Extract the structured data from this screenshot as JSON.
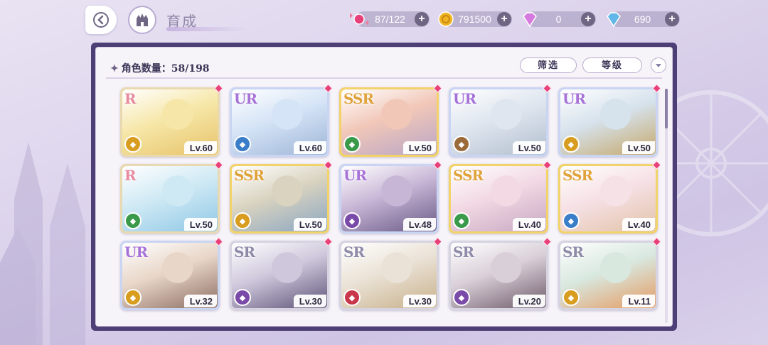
{
  "header": {
    "title": "育成",
    "back_icon": "back-arrow-icon",
    "home_icon": "castle-home-icon"
  },
  "resources": [
    {
      "name": "candy",
      "icon": "candy-icon",
      "value": "87/122",
      "color": "#e8417a"
    },
    {
      "name": "gold",
      "icon": "gold-coin-icon",
      "value": "791500",
      "color": "#f0b323"
    },
    {
      "name": "pink-diamond",
      "icon": "pink-diamond-icon",
      "value": "0",
      "color": "#d77adf"
    },
    {
      "name": "blue-diamond",
      "icon": "blue-diamond-icon",
      "value": "690",
      "color": "#62b7e8"
    }
  ],
  "panel": {
    "count_label": "角色数量：58/198",
    "filter_label": "筛选",
    "sort_label": "等级"
  },
  "cards": [
    {
      "rarity": "R",
      "level": "Lv.60",
      "elem": "#d89c1f"
    },
    {
      "rarity": "UR",
      "level": "Lv.60",
      "elem": "#3a7ec9"
    },
    {
      "rarity": "SSR",
      "level": "Lv.50",
      "elem": "#3a9a4a"
    },
    {
      "rarity": "UR",
      "level": "Lv.50",
      "elem": "#9a6a3a"
    },
    {
      "rarity": "UR",
      "level": "Lv.50",
      "elem": "#d89c1f"
    },
    {
      "rarity": "R",
      "level": "Lv.50",
      "elem": "#3a9a4a"
    },
    {
      "rarity": "SSR",
      "level": "Lv.50",
      "elem": "#d89c1f"
    },
    {
      "rarity": "UR",
      "level": "Lv.48",
      "elem": "#7a4aa8"
    },
    {
      "rarity": "SSR",
      "level": "Lv.40",
      "elem": "#3a9a4a"
    },
    {
      "rarity": "SSR",
      "level": "Lv.40",
      "elem": "#3a7ec9"
    },
    {
      "rarity": "UR",
      "level": "Lv.32",
      "elem": "#d89c1f"
    },
    {
      "rarity": "SR",
      "level": "Lv.30",
      "elem": "#7a4aa8"
    },
    {
      "rarity": "SR",
      "level": "Lv.30",
      "elem": "#c8374a"
    },
    {
      "rarity": "SR",
      "level": "Lv.20",
      "elem": "#7a4aa8"
    },
    {
      "rarity": "SR",
      "level": "Lv.11",
      "elem": "#d89c1f"
    }
  ],
  "rarity_styles": {
    "R": {
      "frame": "#e9d9b0",
      "text": "#e78aa0"
    },
    "SR": {
      "frame": "#d7d4e2",
      "text": "#8e8aa8"
    },
    "SSR": {
      "frame": "#f2d36a",
      "text": "#e0a23a"
    },
    "UR": {
      "frame": "#c9d5f3",
      "text": "#a672d8"
    }
  }
}
